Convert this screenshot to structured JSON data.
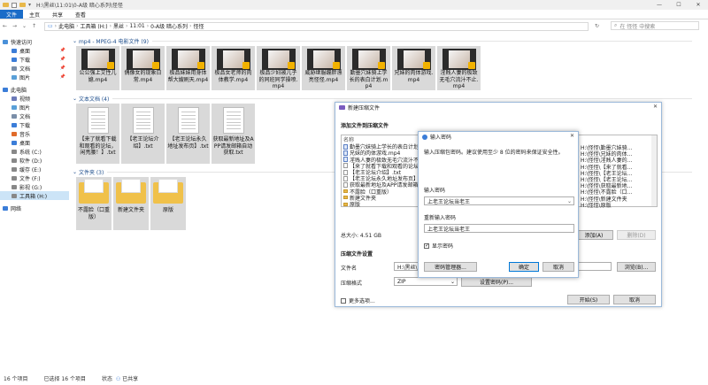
{
  "window": {
    "title": "H:\\黑丝\\11:01\\0-A级 暗心系列\\怪怪",
    "controls": [
      "—",
      "☐",
      "✕"
    ]
  },
  "ribbon": {
    "tabs": [
      "文件",
      "主页",
      "共享",
      "查看"
    ]
  },
  "address": {
    "crumbs": [
      "此电脑",
      "工具箱 (H:)",
      "黑丝",
      "11:01",
      "0-A级 暗心系列",
      "怪怪"
    ],
    "search_placeholder": "在 怪怪 中搜索"
  },
  "nav": {
    "items": [
      {
        "label": "快速访问",
        "level": 0,
        "pin": false,
        "color": "#4a90d9"
      },
      {
        "label": "桌面",
        "level": 1,
        "pin": true,
        "color": "#3b7dd8"
      },
      {
        "label": "下载",
        "level": 1,
        "pin": true,
        "color": "#3b7dd8"
      },
      {
        "label": "文档",
        "level": 1,
        "pin": true,
        "color": "#7a8ea8"
      },
      {
        "label": "图片",
        "level": 1,
        "pin": true,
        "color": "#5aa0d8"
      },
      {
        "label": "此电脑",
        "level": 0,
        "pin": false,
        "color": "#3b7dd8"
      },
      {
        "label": "视频",
        "level": 1,
        "pin": false,
        "color": "#6c7ab8"
      },
      {
        "label": "图片",
        "level": 1,
        "pin": false,
        "color": "#5aa0d8"
      },
      {
        "label": "文档",
        "level": 1,
        "pin": false,
        "color": "#7a8ea8"
      },
      {
        "label": "下载",
        "level": 1,
        "pin": false,
        "color": "#3b7dd8"
      },
      {
        "label": "音乐",
        "level": 1,
        "pin": false,
        "color": "#e06b2a"
      },
      {
        "label": "桌面",
        "level": 1,
        "pin": false,
        "color": "#3b7dd8"
      },
      {
        "label": "系统 (C:)",
        "level": 1,
        "pin": false,
        "color": "#888888"
      },
      {
        "label": "软件 (D:)",
        "level": 1,
        "pin": false,
        "color": "#888888"
      },
      {
        "label": "缓存 (E:)",
        "level": 1,
        "pin": false,
        "color": "#888888"
      },
      {
        "label": "文件 (F:)",
        "level": 1,
        "pin": false,
        "color": "#888888"
      },
      {
        "label": "影视 (G:)",
        "level": 1,
        "pin": false,
        "color": "#888888"
      },
      {
        "label": "工具箱 (H:)",
        "level": 1,
        "pin": false,
        "color": "#888888",
        "selected": true
      },
      {
        "label": "网络",
        "level": 0,
        "pin": false,
        "color": "#3b7dd8"
      }
    ]
  },
  "groups": {
    "video": {
      "title": "mp4 - MPEG-4 电影文件 (9)"
    },
    "text": {
      "title": "文本文档 (4)"
    },
    "folder": {
      "title": "文件夹 (3)"
    }
  },
  "videos": [
    "公公强上艾性儿媳.mp4",
    "偶像女的现象日常.mp4",
    "极品妹妹用身体帮大嫂刷天.mp4",
    "极品女老师的肉体教学.mp4",
    "极品少妇被儿子的同班同学操喷.mp4",
    "威胁继服蹦胖漂亮怪怪.mp4",
    "勤墨穴妹骑上学长的表白计划.mp4",
    "兄妹的肉体游戏.mp4",
    "淫贱人妻的极致无毛穴流汁不止.mp4"
  ],
  "texts": [
    "【来了就看下载和观看的论坛，闲亮腰！】.txt",
    "【老王论坛介绍】.txt",
    "【老王论坛永久地址发布页】.txt",
    "获取最新地址及APP请发邮箱自动获取.txt"
  ],
  "folders": [
    "不露脸（口重版）",
    "新建文件夹",
    "原版"
  ],
  "status": {
    "count": "16 个项目",
    "selected": "已选择 16 个项目",
    "state_label": "状态",
    "state": "已共享"
  },
  "archive_dialog": {
    "title": "新建压缩文件",
    "section_add": "添加文件到压缩文件",
    "col_name": "名称",
    "list_left": [
      "勤墨穴妹骑上学长的表白计划.mp4",
      "兄妹的肉体游戏.mp4",
      "淫贱人妻的极致无毛穴流汁不止.mp4",
      "【来了就看下载和观看的论坛.txt",
      "【老王论坛介绍】.txt",
      "【老王论坛永久地址发布页】.txt",
      "获取最新地址及APP请发邮箱自动获取.txt",
      "不露脸（口重版）",
      "新建文件夹",
      "原版"
    ],
    "list_right": [
      "H:\\怪怪\\勤墨穴妹骑...",
      "H:\\怪怪\\兄妹的肉体...",
      "H:\\怪怪\\淫贱人妻的...",
      "H:\\怪怪\\【来了就看...",
      "H:\\怪怪\\【老王论坛...",
      "H:\\怪怪\\【老王论坛...",
      "H:\\怪怪\\获取最新地...",
      "H:\\怪怪\\不露脸（口...",
      "H:\\怪怪\\新建文件夹",
      "H:\\怪怪\\原版"
    ],
    "total_size": "总大小: 4.51 GB",
    "add_button": "添加(A)",
    "delete_button": "删除(D)",
    "section_settings": "压缩文件设置",
    "filename_label": "文件名",
    "filename_value": "H:\\黑丝\\11:01\\0-A级 暗心系列\\怪怪.zip",
    "browse_button": "浏览(B)...",
    "format_label": "压缩格式",
    "format_value": "ZIP",
    "password_button": "设置密码(P)...",
    "more_label": "更多选项...",
    "start_button": "开始(S)",
    "cancel_button": "取消"
  },
  "password_dialog": {
    "title": "输入密码",
    "hint": "输入压缩包密码。建议使用至少 8 位的密码来保证安全性。",
    "password_label": "输入密码",
    "password_value": "上老王论坛当老王",
    "confirm_label": "重新输入密码",
    "confirm_value": "上老王论坛当老王",
    "show_password_label": "显示密码",
    "manager_button": "密码管理器...",
    "ok_button": "确定",
    "cancel_button": "取消"
  }
}
